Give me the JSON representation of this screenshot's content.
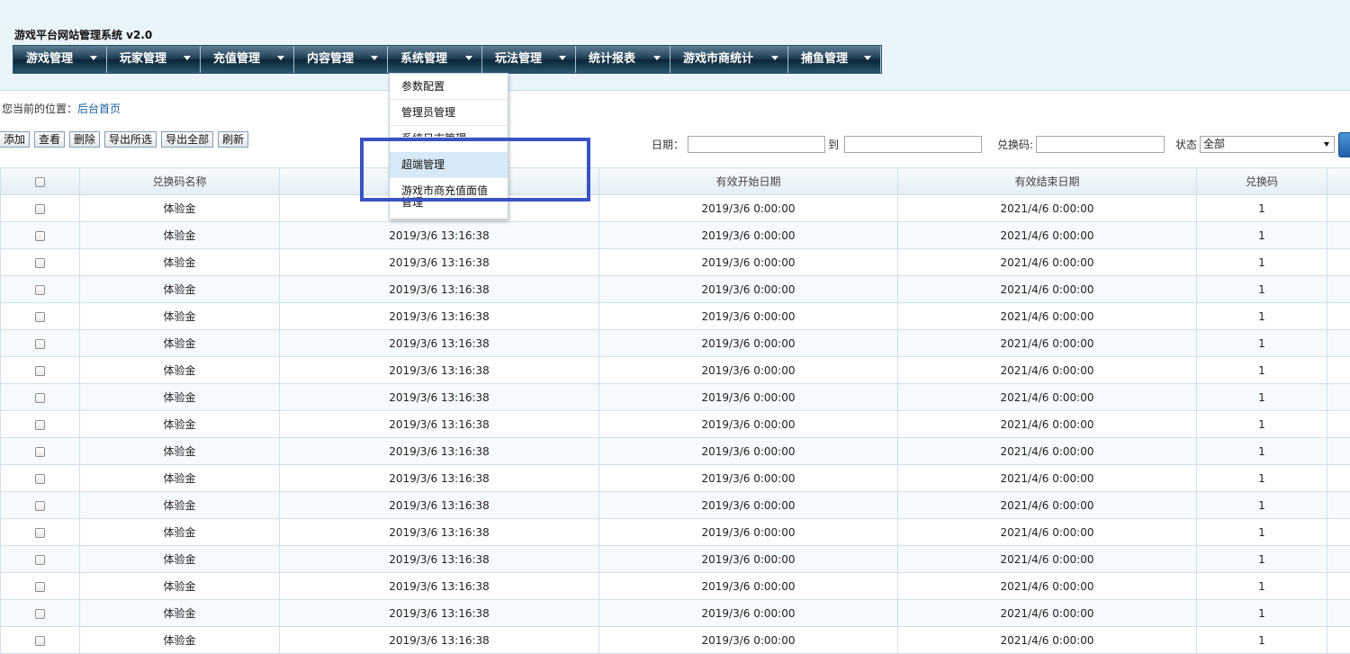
{
  "app": {
    "title": "游戏平台网站管理系统 v2.0"
  },
  "nav": {
    "items": [
      {
        "label": "游戏管理"
      },
      {
        "label": "玩家管理"
      },
      {
        "label": "充值管理"
      },
      {
        "label": "内容管理"
      },
      {
        "label": "系统管理"
      },
      {
        "label": "玩法管理"
      },
      {
        "label": "统计报表"
      },
      {
        "label": "游戏市商统计"
      },
      {
        "label": "捕鱼管理"
      }
    ]
  },
  "dropdown": {
    "items": [
      {
        "label": "参数配置"
      },
      {
        "label": "管理员管理"
      },
      {
        "label": "系统日志管理"
      },
      {
        "label": "超端管理"
      },
      {
        "label": "游戏市商充值面值"
      }
    ],
    "overflow_text": "管理"
  },
  "breadcrumb": {
    "prefix": "您当前的位置：",
    "link": "后台首页"
  },
  "toolbar": {
    "add": "添加",
    "view": "查看",
    "delete": "删除",
    "export_selected": "导出所选",
    "export_all": "导出全部",
    "refresh": "刷新"
  },
  "filters": {
    "date_label": "日期：",
    "to_label": "到",
    "code_label": "兑换码:",
    "status_label": "状态",
    "status_value": "全部"
  },
  "table": {
    "columns": [
      "兑换码名称",
      "",
      "有效开始日期",
      "有效结束日期",
      "兑换码"
    ],
    "rows": [
      [
        "体验金",
        "",
        "2019/3/6 0:00:00",
        "2021/4/6 0:00:00",
        "1"
      ],
      [
        "体验金",
        "2019/3/6 13:16:38",
        "2019/3/6 0:00:00",
        "2021/4/6 0:00:00",
        "1"
      ],
      [
        "体验金",
        "2019/3/6 13:16:38",
        "2019/3/6 0:00:00",
        "2021/4/6 0:00:00",
        "1"
      ],
      [
        "体验金",
        "2019/3/6 13:16:38",
        "2019/3/6 0:00:00",
        "2021/4/6 0:00:00",
        "1"
      ],
      [
        "体验金",
        "2019/3/6 13:16:38",
        "2019/3/6 0:00:00",
        "2021/4/6 0:00:00",
        "1"
      ],
      [
        "体验金",
        "2019/3/6 13:16:38",
        "2019/3/6 0:00:00",
        "2021/4/6 0:00:00",
        "1"
      ],
      [
        "体验金",
        "2019/3/6 13:16:38",
        "2019/3/6 0:00:00",
        "2021/4/6 0:00:00",
        "1"
      ],
      [
        "体验金",
        "2019/3/6 13:16:38",
        "2019/3/6 0:00:00",
        "2021/4/6 0:00:00",
        "1"
      ],
      [
        "体验金",
        "2019/3/6 13:16:38",
        "2019/3/6 0:00:00",
        "2021/4/6 0:00:00",
        "1"
      ],
      [
        "体验金",
        "2019/3/6 13:16:38",
        "2019/3/6 0:00:00",
        "2021/4/6 0:00:00",
        "1"
      ],
      [
        "体验金",
        "2019/3/6 13:16:38",
        "2019/3/6 0:00:00",
        "2021/4/6 0:00:00",
        "1"
      ],
      [
        "体验金",
        "2019/3/6 13:16:38",
        "2019/3/6 0:00:00",
        "2021/4/6 0:00:00",
        "1"
      ],
      [
        "体验金",
        "2019/3/6 13:16:38",
        "2019/3/6 0:00:00",
        "2021/4/6 0:00:00",
        "1"
      ],
      [
        "体验金",
        "2019/3/6 13:16:38",
        "2019/3/6 0:00:00",
        "2021/4/6 0:00:00",
        "1"
      ],
      [
        "体验金",
        "2019/3/6 13:16:38",
        "2019/3/6 0:00:00",
        "2021/4/6 0:00:00",
        "1"
      ],
      [
        "体验金",
        "2019/3/6 13:16:38",
        "2019/3/6 0:00:00",
        "2021/4/6 0:00:00",
        "1"
      ],
      [
        "体验金",
        "2019/3/6 13:16:38",
        "2019/3/6 0:00:00",
        "2021/4/6 0:00:00",
        "1"
      ]
    ]
  },
  "colors": {
    "highlight": "#3b52c4",
    "nav_dark": "#0c2536",
    "header_bg": "#eaf4fb"
  }
}
